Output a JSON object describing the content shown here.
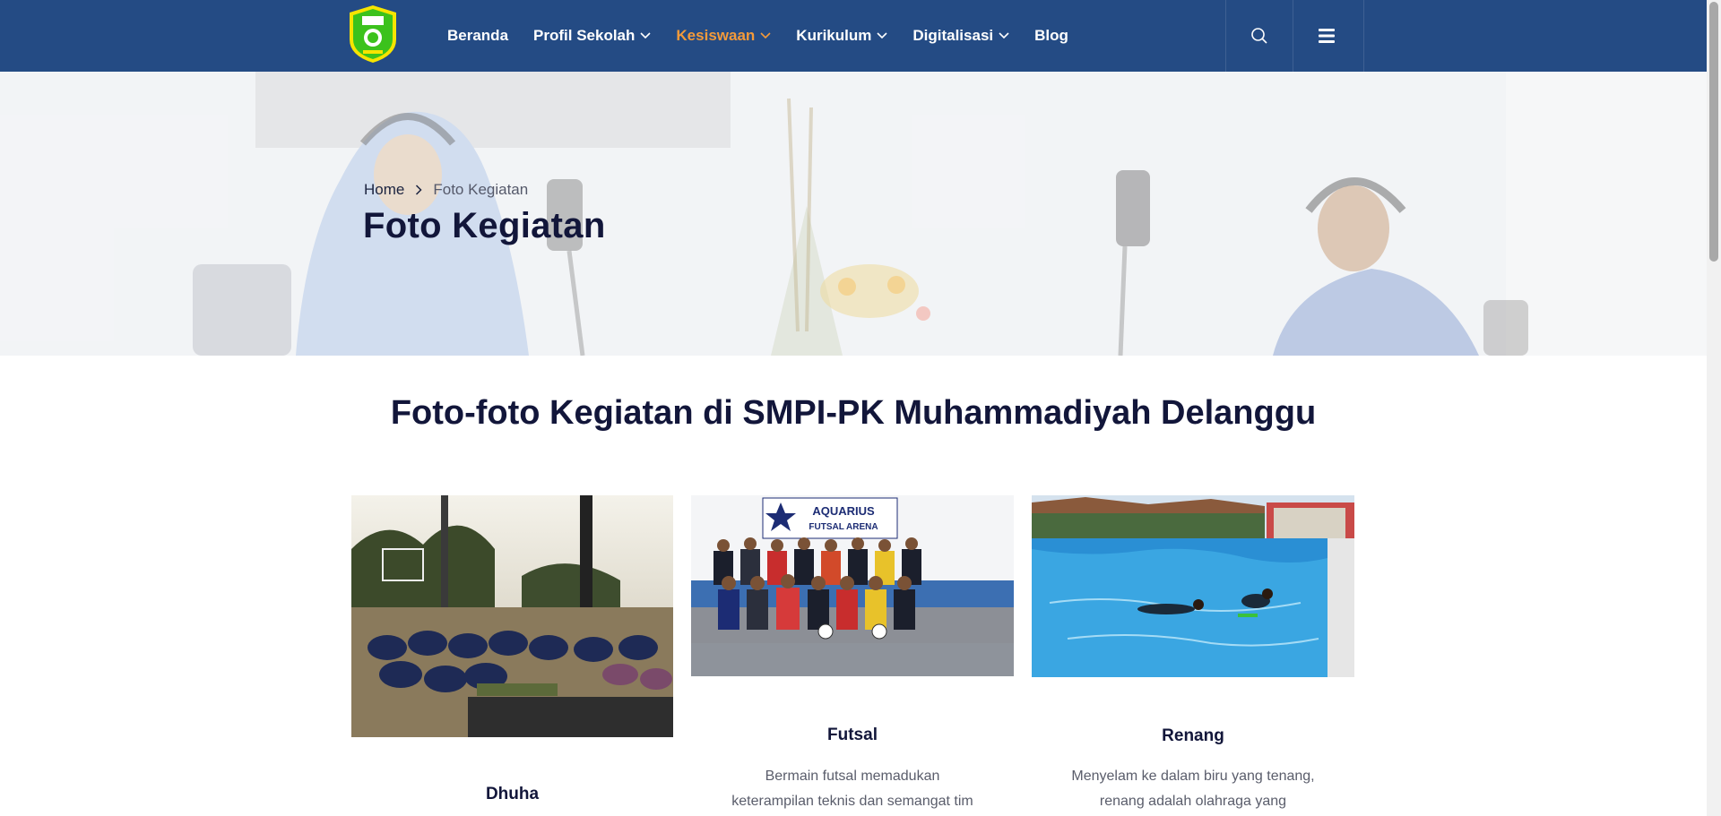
{
  "header": {
    "logo_icon": "school-crest-logo",
    "nav": [
      {
        "label": "Beranda",
        "dropdown": false,
        "active": false
      },
      {
        "label": "Profil Sekolah",
        "dropdown": true,
        "active": false
      },
      {
        "label": "Kesiswaan",
        "dropdown": true,
        "active": true
      },
      {
        "label": "Kurikulum",
        "dropdown": true,
        "active": false
      },
      {
        "label": "Digitalisasi",
        "dropdown": true,
        "active": false
      },
      {
        "label": "Blog",
        "dropdown": false,
        "active": false
      }
    ],
    "search_icon": "search-icon",
    "menu_icon": "hamburger-menu-icon"
  },
  "hero": {
    "breadcrumb_home": "Home",
    "breadcrumb_current": "Foto Kegiatan",
    "title": "Foto Kegiatan"
  },
  "section": {
    "title": "Foto-foto Kegiatan di SMPI-PK Muhammadiyah Delanggu"
  },
  "cards": [
    {
      "title": "Dhuha",
      "desc_line1": "",
      "desc_line2": ""
    },
    {
      "title": "Futsal",
      "desc_line1": "Bermain futsal memadukan",
      "desc_line2": "keterampilan teknis dan semangat tim"
    },
    {
      "title": "Renang",
      "desc_line1": "Menyelam ke dalam biru yang tenang,",
      "desc_line2": "renang adalah olahraga yang"
    }
  ],
  "photo_text": {
    "futsal_banner_line1": "AQUARIUS",
    "futsal_banner_line2": "FUTSAL ARENA"
  },
  "colors": {
    "header_bg": "#244b84",
    "nav_active": "#f39a3a",
    "title_text": "#12163a"
  }
}
